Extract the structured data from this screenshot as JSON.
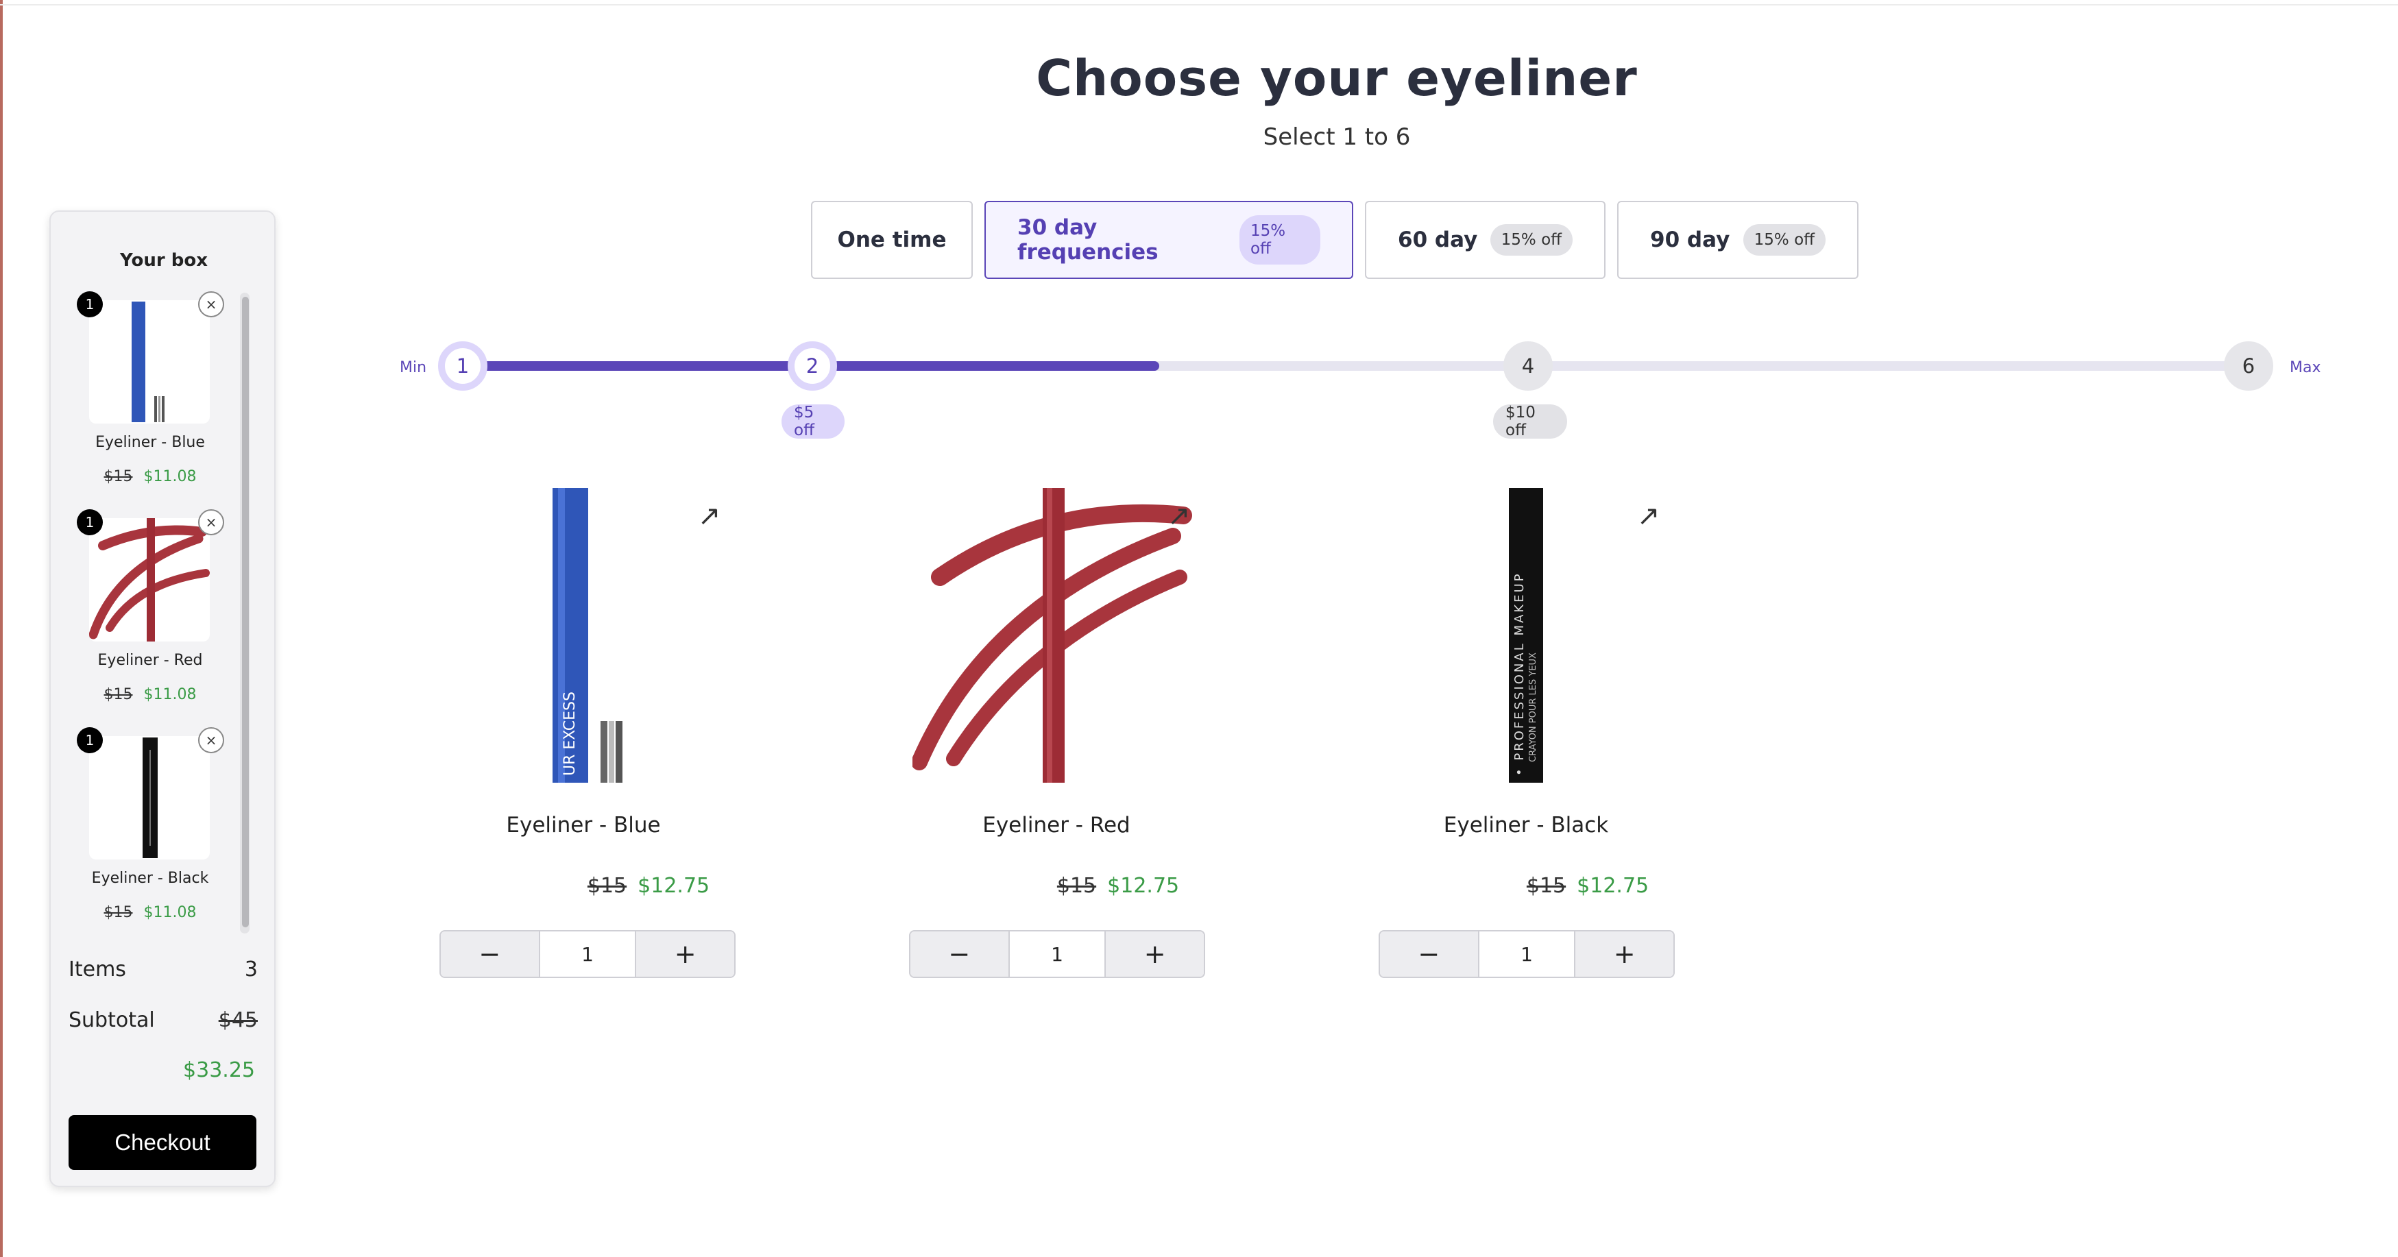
{
  "header": {
    "title": "Choose your eyeliner",
    "subtitle": "Select 1 to 6"
  },
  "frequencies": [
    {
      "label": "One time",
      "badge": ""
    },
    {
      "label": "30 day frequencies",
      "badge": "15% off",
      "selected": true
    },
    {
      "label": "60 day",
      "badge": "15% off"
    },
    {
      "label": "90 day",
      "badge": "15% off"
    }
  ],
  "slider": {
    "min_label": "Min",
    "max_label": "Max",
    "nodes": [
      "1",
      "2",
      "4",
      "6"
    ],
    "discounts": [
      "$5 off",
      "$10 off"
    ],
    "progress_fraction": 0.39
  },
  "sidebar": {
    "title": "Your box",
    "items": [
      {
        "qty": "1",
        "name": "Eyeliner - Blue",
        "old_price": "$15",
        "new_price": "$11.08"
      },
      {
        "qty": "1",
        "name": "Eyeliner - Red",
        "old_price": "$15",
        "new_price": "$11.08"
      },
      {
        "qty": "1",
        "name": "Eyeliner - Black",
        "old_price": "$15",
        "new_price": "$11.08"
      }
    ],
    "remove_glyph": "×",
    "items_label": "Items",
    "items_count": "3",
    "subtotal_label": "Subtotal",
    "subtotal_old": "$45",
    "subtotal_new": "$33.25",
    "checkout_label": "Checkout"
  },
  "products": [
    {
      "name": "Eyeliner - Blue",
      "old_price": "$15",
      "new_price": "$12.75",
      "qty": "1",
      "color": "#2f56b8"
    },
    {
      "name": "Eyeliner - Red",
      "old_price": "$15",
      "new_price": "$12.75",
      "qty": "1",
      "color": "#a8353d"
    },
    {
      "name": "Eyeliner - Black",
      "old_price": "$15",
      "new_price": "$12.75",
      "qty": "1",
      "color": "#111111"
    }
  ],
  "stepper": {
    "minus": "−",
    "plus": "+"
  },
  "external_glyph": "↗",
  "pencil_text": {
    "blue_brand": "UR EXCESS",
    "black_brand": "• PROFESSIONAL MAKEUP",
    "black_sub": "CRAYON POUR LES YEUX"
  }
}
